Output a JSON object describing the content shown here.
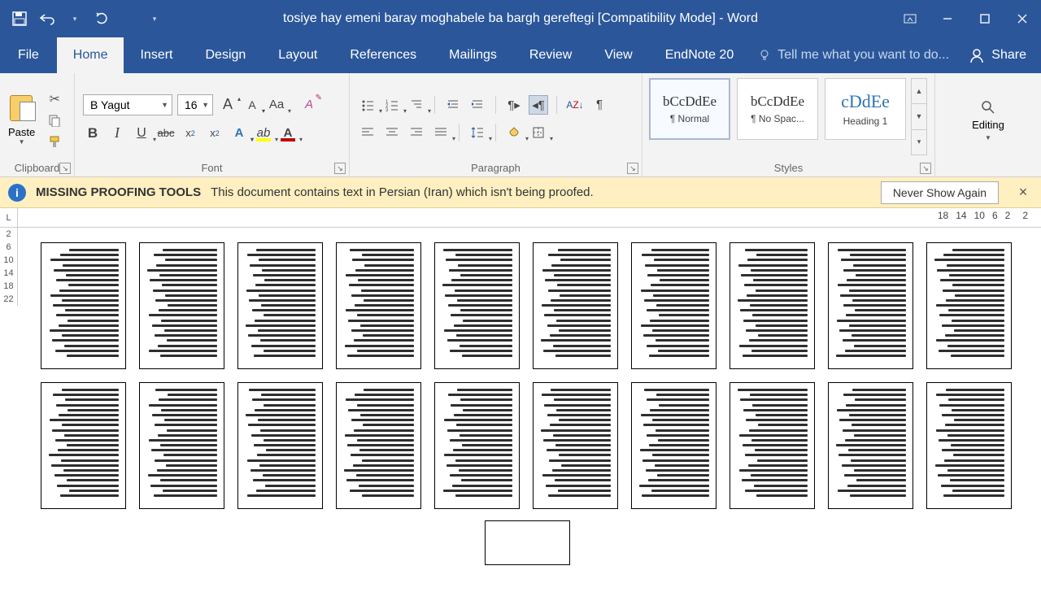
{
  "titlebar": {
    "title": "tosiye hay emeni baray moghabele ba bargh gereftegi [Compatibility Mode] - Word"
  },
  "tabs": {
    "file": "File",
    "home": "Home",
    "insert": "Insert",
    "design": "Design",
    "layout": "Layout",
    "references": "References",
    "mailings": "Mailings",
    "review": "Review",
    "view": "View",
    "endnote": "EndNote 20",
    "tellme": "Tell me what you want to do...",
    "share": "Share"
  },
  "ribbon": {
    "clipboard": {
      "label": "Clipboard",
      "paste": "Paste"
    },
    "font": {
      "label": "Font",
      "name": "B Yagut",
      "size": "16",
      "changecase": "Aa"
    },
    "paragraph": {
      "label": "Paragraph"
    },
    "styles": {
      "label": "Styles",
      "items": [
        {
          "preview": "bCcDdEe",
          "name": "¶ Normal"
        },
        {
          "preview": "bCcDdEe",
          "name": "¶ No Spac..."
        },
        {
          "preview": "cDdEe",
          "name": "Heading 1"
        }
      ]
    },
    "editing": {
      "label": "Editing"
    }
  },
  "msgbar": {
    "title": "MISSING PROOFING TOOLS",
    "text": "This document contains text in Persian (Iran) which isn't being proofed.",
    "button": "Never Show Again"
  },
  "ruler": {
    "h": [
      "18",
      "14",
      "10",
      "6",
      "2",
      "2"
    ],
    "v": [
      "2",
      "6",
      "10",
      "14",
      "18",
      "22"
    ]
  }
}
